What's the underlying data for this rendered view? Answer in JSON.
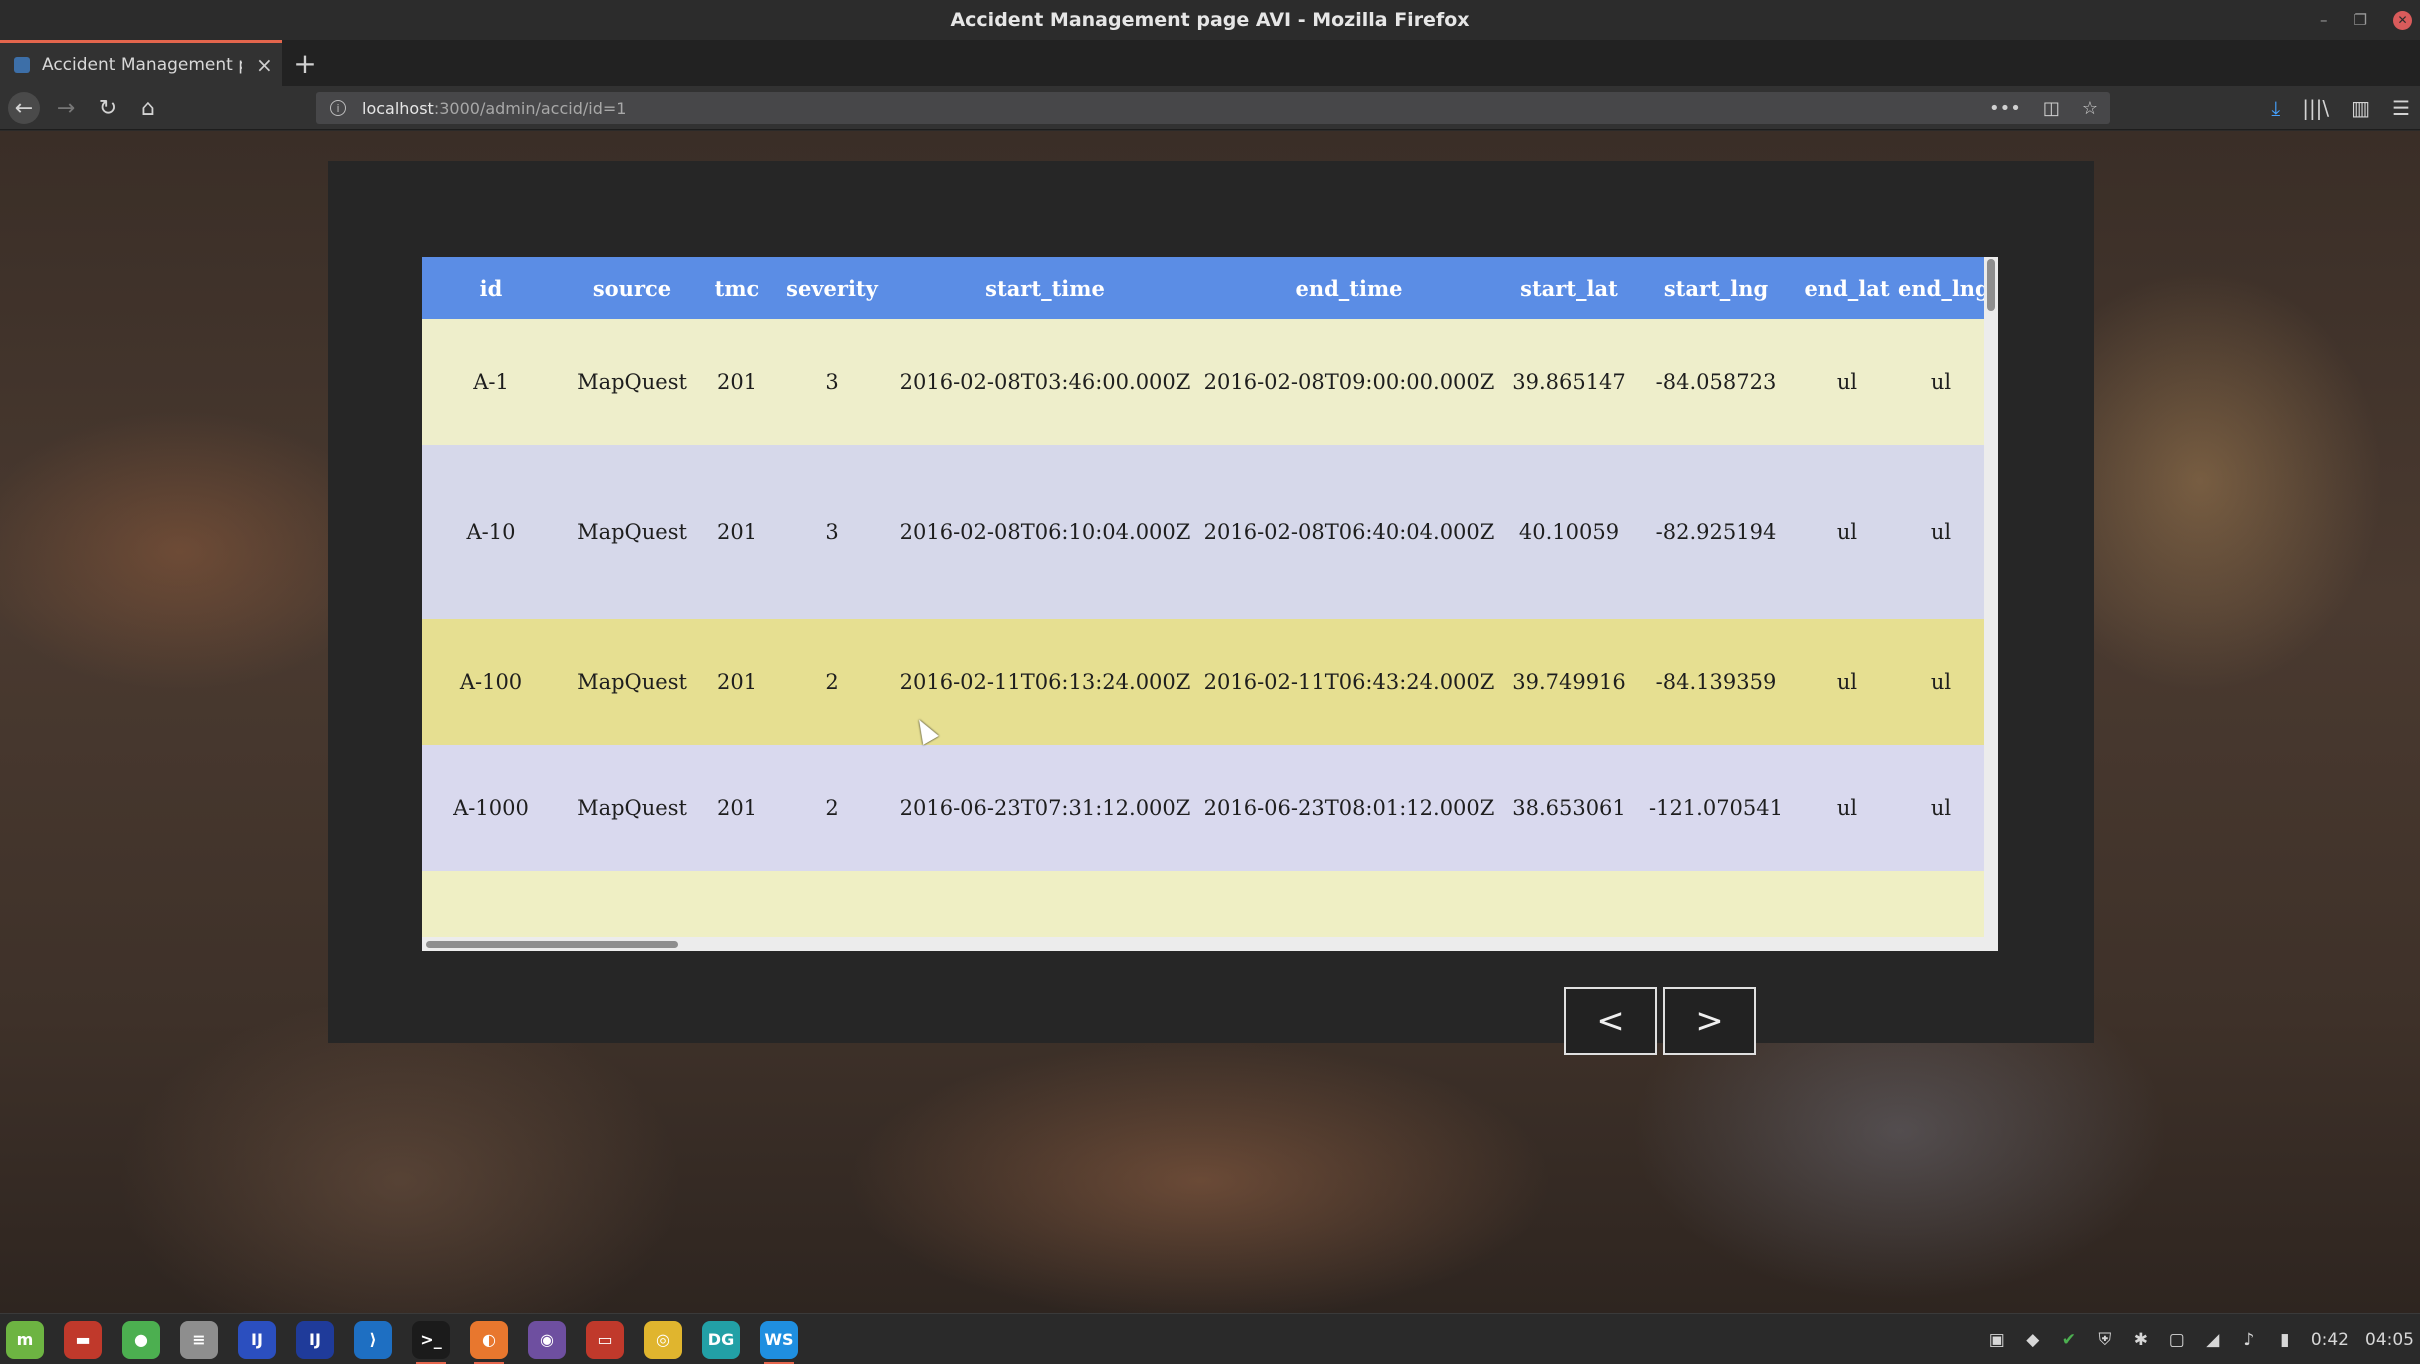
{
  "window": {
    "title": "Accident Management page AVI - Mozilla Firefox",
    "controls": [
      "–",
      "❐",
      "✕"
    ]
  },
  "tab": {
    "title": "Accident Management page AVI",
    "close": "×",
    "new": "+"
  },
  "nav": {
    "back": "←",
    "forward": "→",
    "reload": "↻",
    "home": "⌂",
    "url_host": "localhost",
    "url_path": ":3000/admin/accid/id=1",
    "info": "i",
    "actions": [
      "•••",
      "◫",
      "☆"
    ],
    "tools": [
      "⤓",
      "|||\\",
      "▥",
      "☰"
    ]
  },
  "table": {
    "columns": [
      "id",
      "source",
      "tmc",
      "severity",
      "start_time",
      "end_time",
      "start_lat",
      "start_lng",
      "end_lat",
      "end_lng"
    ],
    "rows": [
      [
        "A-1",
        "MapQuest",
        "201",
        "3",
        "2016-02-08T03:46:00.000Z",
        "2016-02-08T09:00:00.000Z",
        "39.865147",
        "-84.058723",
        "ul",
        "ul"
      ],
      [
        "A-10",
        "MapQuest",
        "201",
        "3",
        "2016-02-08T06:10:04.000Z",
        "2016-02-08T06:40:04.000Z",
        "40.10059",
        "-82.925194",
        "ul",
        "ul"
      ],
      [
        "A-100",
        "MapQuest",
        "201",
        "2",
        "2016-02-11T06:13:24.000Z",
        "2016-02-11T06:43:24.000Z",
        "39.749916",
        "-84.139359",
        "ul",
        "ul"
      ],
      [
        "A-1000",
        "MapQuest",
        "201",
        "2",
        "2016-06-23T07:31:12.000Z",
        "2016-06-23T08:01:12.000Z",
        "38.653061",
        "-121.070541",
        "ul",
        "ul"
      ]
    ]
  },
  "pager": {
    "prev": "<",
    "next": ">"
  },
  "taskbar": {
    "apps": [
      {
        "name": "mint-menu",
        "glyph": "m",
        "color": "#6db442"
      },
      {
        "name": "files",
        "glyph": "▬",
        "color": "#c0392b"
      },
      {
        "name": "terminal-green",
        "glyph": "●",
        "color": "#4caf50"
      },
      {
        "name": "settings",
        "glyph": "≡",
        "color": "#8e8e8e"
      },
      {
        "name": "intellij-1",
        "glyph": "IJ",
        "color": "#2b4fbf"
      },
      {
        "name": "intellij-2",
        "glyph": "IJ",
        "color": "#1f3b9a"
      },
      {
        "name": "vscode",
        "glyph": "⟩",
        "color": "#1e6fc2"
      },
      {
        "name": "terminal",
        "glyph": ">_",
        "color": "#1b1b1b"
      },
      {
        "name": "firefox",
        "glyph": "◐",
        "color": "#e8772e"
      },
      {
        "name": "github",
        "glyph": "◉",
        "color": "#6e4fa0"
      },
      {
        "name": "folder",
        "glyph": "▭",
        "color": "#c0392b"
      },
      {
        "name": "chrome",
        "glyph": "◎",
        "color": "#e0b52e"
      },
      {
        "name": "datagrip",
        "glyph": "DG",
        "color": "#22a0a6"
      },
      {
        "name": "webstorm",
        "glyph": "WS",
        "color": "#1f8fe0"
      }
    ],
    "tray_icons": [
      "▣",
      "◆",
      "✔",
      "⛨",
      "✱",
      "▢",
      "◢",
      "♪",
      "▮"
    ],
    "battery_time": "0:42",
    "clock": "04:05"
  }
}
